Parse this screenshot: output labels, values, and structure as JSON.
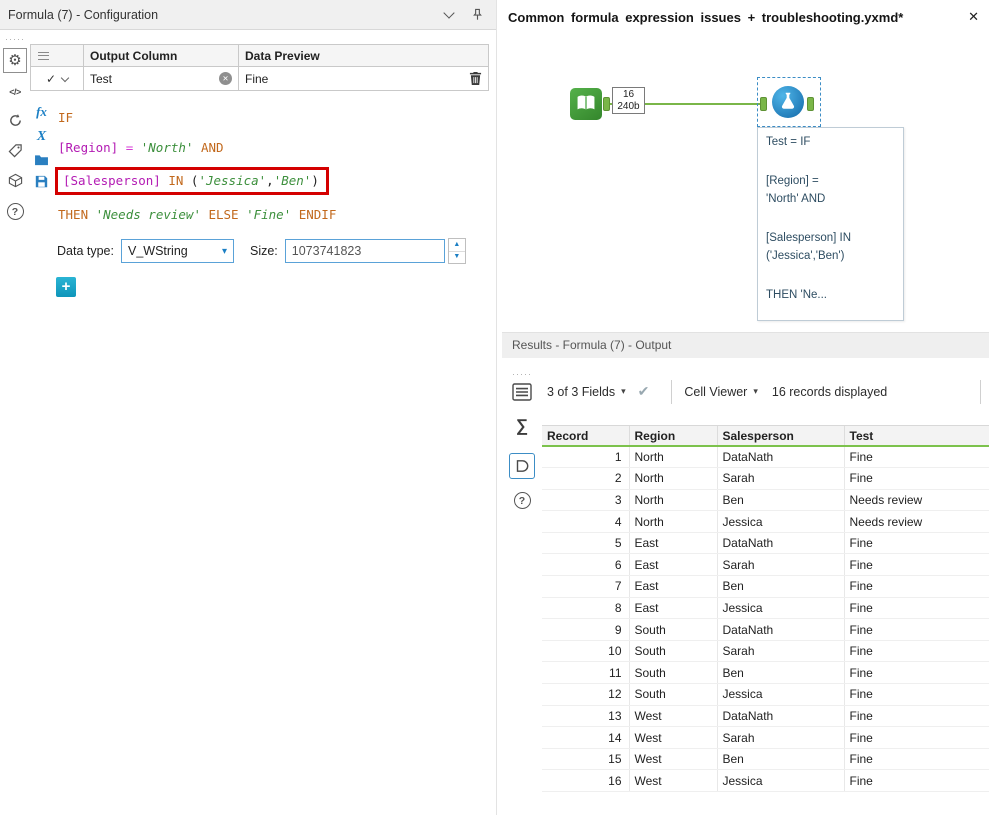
{
  "icons": {
    "drag_dots": "·····",
    "gear": "⚙",
    "code_tag": "</>",
    "help": "?",
    "functions": "fx",
    "variables": "X",
    "row_check": "✓",
    "clear_x": "✕",
    "close_x": "✕",
    "dropdown_arrow": "▾",
    "spinner_up": "▲",
    "spinner_down": "▼",
    "apply_check": "✔",
    "sum": "∑",
    "plus": "+"
  },
  "config_panel": {
    "title": "Formula (7) - Configuration",
    "grid": {
      "header_output": "Output Column",
      "header_preview": "Data Preview",
      "row": {
        "name": "Test",
        "preview": "Fine"
      }
    },
    "expression": {
      "line1": {
        "kw": "IF"
      },
      "line2": {
        "field": "[Region]",
        "op": "=",
        "str": "'North'",
        "kw": "AND"
      },
      "line3": {
        "field": "[Salesperson]",
        "kw": "IN",
        "open": "(",
        "str1": "'Jessica'",
        "comma": ",",
        "str2": "'Ben'",
        "close": ")"
      },
      "line4": {
        "kw1": "THEN",
        "str1": "'Needs review'",
        "kw2": "ELSE",
        "str2": "'Fine'",
        "kw3": "ENDIF"
      }
    },
    "data_type_label": "Data type:",
    "data_type_value": "V_WString",
    "size_label": "Size:",
    "size_value": "1073741823"
  },
  "canvas": {
    "title": "Common formula expression issues + troubleshooting.yxmd*",
    "connection": {
      "records": "16",
      "size": "240b"
    },
    "annotation_lines": [
      "Test = IF",
      "",
      "[Region] =",
      "'North' AND",
      "",
      "[Salesperson] IN",
      "('Jessica','Ben')",
      "",
      "THEN 'Ne..."
    ]
  },
  "results": {
    "title": "Results - Formula (7) - Output",
    "fields_dropdown": "3 of 3 Fields",
    "cell_viewer": "Cell Viewer",
    "records_label": "16 records displayed",
    "table": {
      "headers": [
        "Record",
        "Region",
        "Salesperson",
        "Test"
      ],
      "rows": [
        [
          "1",
          "North",
          "DataNath",
          "Fine"
        ],
        [
          "2",
          "North",
          "Sarah",
          "Fine"
        ],
        [
          "3",
          "North",
          "Ben",
          "Needs review"
        ],
        [
          "4",
          "North",
          "Jessica",
          "Needs review"
        ],
        [
          "5",
          "East",
          "DataNath",
          "Fine"
        ],
        [
          "6",
          "East",
          "Sarah",
          "Fine"
        ],
        [
          "7",
          "East",
          "Ben",
          "Fine"
        ],
        [
          "8",
          "East",
          "Jessica",
          "Fine"
        ],
        [
          "9",
          "South",
          "DataNath",
          "Fine"
        ],
        [
          "10",
          "South",
          "Sarah",
          "Fine"
        ],
        [
          "11",
          "South",
          "Ben",
          "Fine"
        ],
        [
          "12",
          "South",
          "Jessica",
          "Fine"
        ],
        [
          "13",
          "West",
          "DataNath",
          "Fine"
        ],
        [
          "14",
          "West",
          "Sarah",
          "Fine"
        ],
        [
          "15",
          "West",
          "Ben",
          "Fine"
        ],
        [
          "16",
          "West",
          "Jessica",
          "Fine"
        ]
      ]
    }
  }
}
